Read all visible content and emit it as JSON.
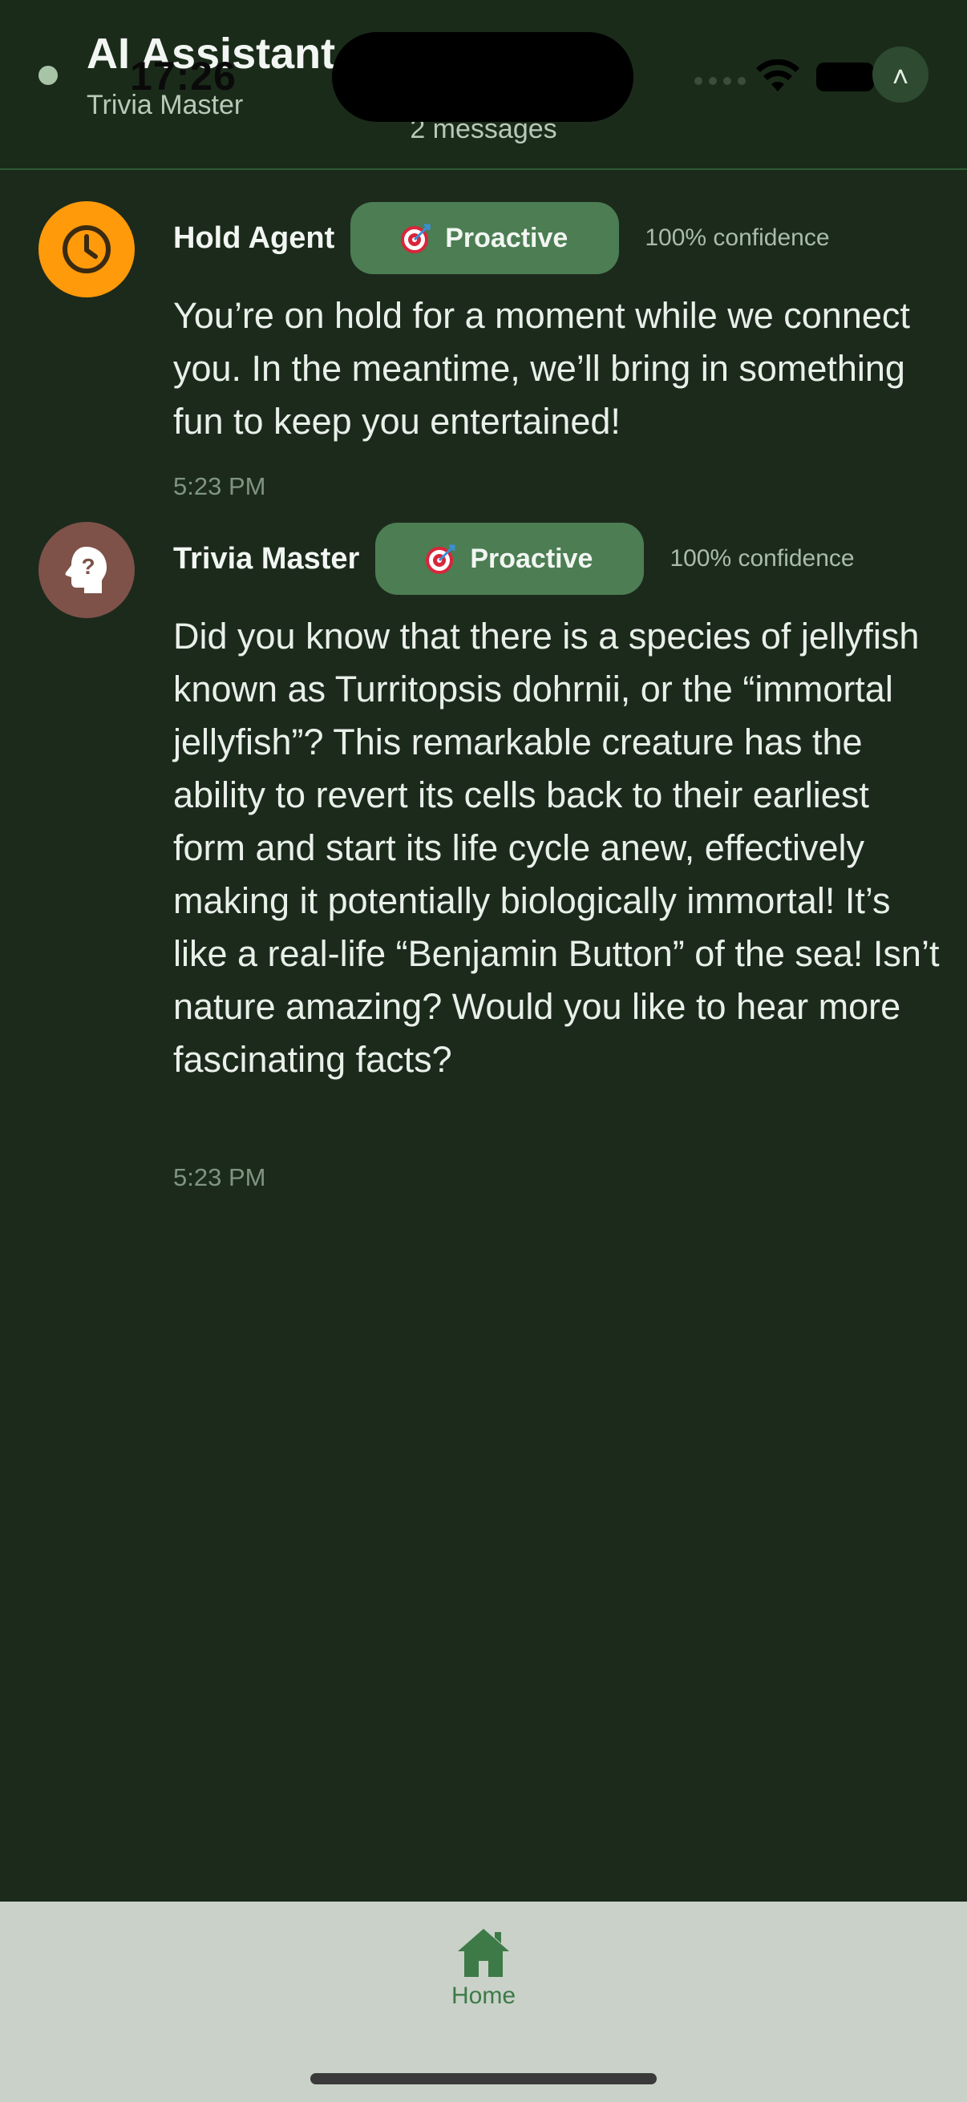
{
  "status_bar": {
    "time": "17:26"
  },
  "header": {
    "title": "AI Assistant C",
    "subtitle": "Trivia Master",
    "message_count": "2 messages",
    "collapse_icon": "chevron-up-icon"
  },
  "messages": [
    {
      "sender": "Hold Agent",
      "avatar_icon": "clock-icon",
      "avatar_color": "#ff9a0a",
      "badge_label": "Proactive",
      "badge_icon": "dart-target-icon",
      "confidence": "100% confidence",
      "text": "You’re on hold for a moment while we connect you. In the meantime, we’ll bring in something fun to keep you entertained!",
      "time": "5:23 PM"
    },
    {
      "sender": "Trivia Master",
      "avatar_icon": "head-question-icon",
      "avatar_color": "#7e5248",
      "badge_label": "Proactive",
      "badge_icon": "dart-target-icon",
      "confidence": "100% confidence",
      "text": "Did you know that there is a species of jellyfish known as Turritopsis dohrnii, or the “immortal jellyfish”? This remarkable creature has the ability to revert its cells back to their earliest form and start its life cycle anew, effectively making it potentially biologically immortal! It’s like a real-life “Benjamin Button” of the sea! Isn’t nature amazing? Would you like to hear more fascinating facts?",
      "time": "5:23 PM"
    }
  ],
  "tab_bar": {
    "home_label": "Home",
    "home_icon": "home-icon",
    "accent_color": "#3d7a47"
  }
}
